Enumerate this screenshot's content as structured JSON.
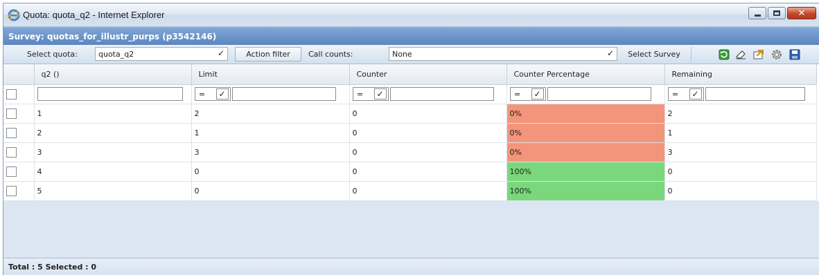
{
  "window": {
    "title": "Quota: quota_q2 - Internet Explorer",
    "minimize_glyph": "",
    "close_glyph": "✕"
  },
  "survey_bar": {
    "text": "Survey: quotas_for_illustr_purps (p3542146)"
  },
  "toolbar": {
    "select_quota_label": "Select quota:",
    "select_quota_value": "quota_q2",
    "action_filter_label": "Action filter",
    "call_counts_label": "Call counts:",
    "call_counts_value": "None",
    "select_survey_label": "Select Survey",
    "icons": [
      "refresh-icon",
      "eraser-icon",
      "export-icon",
      "gear-icon",
      "save-icon"
    ]
  },
  "grid": {
    "columns": [
      "q2 ()",
      "Limit",
      "Counter",
      "Counter Percentage",
      "Remaining"
    ],
    "filter_op": "=",
    "rows": [
      {
        "q2": "1",
        "limit": "2",
        "counter": "0",
        "pct": "0%",
        "remaining": "2",
        "status": "red"
      },
      {
        "q2": "2",
        "limit": "1",
        "counter": "0",
        "pct": "0%",
        "remaining": "1",
        "status": "red"
      },
      {
        "q2": "3",
        "limit": "3",
        "counter": "0",
        "pct": "0%",
        "remaining": "3",
        "status": "red"
      },
      {
        "q2": "4",
        "limit": "0",
        "counter": "0",
        "pct": "100%",
        "remaining": "0",
        "status": "green"
      },
      {
        "q2": "5",
        "limit": "0",
        "counter": "0",
        "pct": "100%",
        "remaining": "0",
        "status": "green"
      }
    ]
  },
  "footer": {
    "text": "Total : 5 Selected : 0"
  },
  "colors": {
    "red": "#f3957a",
    "green": "#7bd77b",
    "header_blue": "#5c86c0"
  }
}
